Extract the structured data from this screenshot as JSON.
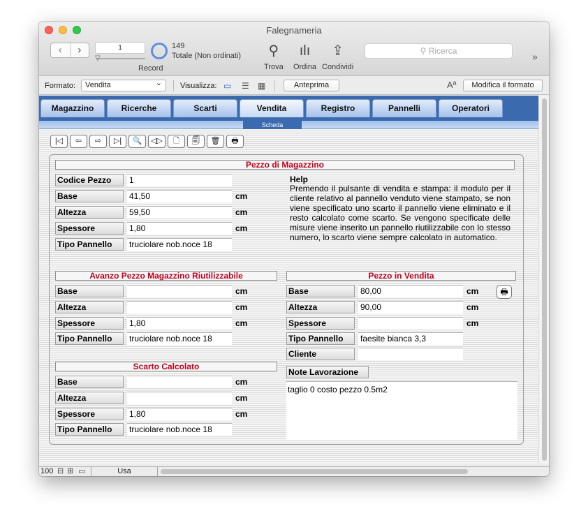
{
  "window": {
    "title": "Falegnameria"
  },
  "toolbar": {
    "record_value": "1",
    "record_label": "Record",
    "count": "149",
    "count_sub": "Totale (Non ordinati)",
    "find_label": "Trova",
    "sort_label": "Ordina",
    "share_label": "Condividi",
    "search_placeholder": "Ricerca",
    "more_icon": "»"
  },
  "formatbar": {
    "format_label": "Formato:",
    "format_value": "Vendita",
    "view_label": "Visualizza:",
    "preview_label": "Anteprima",
    "text_size_icon": "Aª",
    "edit_format_label": "Modifica il formato"
  },
  "tabs": [
    "Magazzino",
    "Ricerche",
    "Scarti",
    "Vendita",
    "Registro",
    "Pannelli",
    "Operatori"
  ],
  "subtab": "Scheda",
  "nav_buttons": [
    "|◁",
    "⇦",
    "⇨",
    "▷|",
    "🔍",
    "◁▷",
    "🗋",
    "🗐",
    "🗑",
    "🖶"
  ],
  "warehouse": {
    "title": "Pezzo di Magazzino",
    "fields": [
      {
        "label": "Codice Pezzo",
        "value": "1",
        "unit": ""
      },
      {
        "label": "Base",
        "value": "41,50",
        "unit": "cm"
      },
      {
        "label": "Altezza",
        "value": "59,50",
        "unit": "cm"
      },
      {
        "label": "Spessore",
        "value": "1,80",
        "unit": "cm"
      },
      {
        "label": "Tipo Pannello",
        "value": "truciolare nob.noce 18",
        "unit": ""
      }
    ]
  },
  "help": {
    "title": "Help",
    "text": "Premendo il pulsante di vendita e stampa: il modulo per il cliente relativo al pannello venduto viene stampato, se non viene specificato uno scarto il pannello viene eliminato e il resto calcolato come scarto. Se vengono specificate delle misure viene inserito un pannello riutilizzabile con lo stesso numero, lo scarto viene sempre calcolato in automatico."
  },
  "reusable": {
    "title": "Avanzo Pezzo Magazzino Riutilizzabile",
    "fields": [
      {
        "label": "Base",
        "value": "",
        "unit": "cm"
      },
      {
        "label": "Altezza",
        "value": "",
        "unit": "cm"
      },
      {
        "label": "Spessore",
        "value": "1,80",
        "unit": "cm"
      },
      {
        "label": "Tipo Pannello",
        "value": "truciolare nob.noce 18",
        "unit": ""
      }
    ]
  },
  "sale": {
    "title": "Pezzo in Vendita",
    "fields": [
      {
        "label": "Base",
        "value": "80,00",
        "unit": "cm"
      },
      {
        "label": "Altezza",
        "value": "90,00",
        "unit": "cm"
      },
      {
        "label": "Spessore",
        "value": "",
        "unit": "cm"
      },
      {
        "label": "Tipo Pannello",
        "value": "faesite bianca 3,3",
        "unit": ""
      },
      {
        "label": "Cliente",
        "value": "",
        "unit": ""
      }
    ],
    "print_icon": "🖶"
  },
  "waste": {
    "title": "Scarto Calcolato",
    "fields": [
      {
        "label": "Base",
        "value": "",
        "unit": "cm"
      },
      {
        "label": "Altezza",
        "value": "",
        "unit": "cm"
      },
      {
        "label": "Spessore",
        "value": "1,80",
        "unit": "cm"
      },
      {
        "label": "Tipo Pannello",
        "value": "truciolare nob.noce 18",
        "unit": ""
      }
    ]
  },
  "notes": {
    "label": "Note Lavorazione",
    "value": "taglio 0 costo pezzo 0.5m2"
  },
  "status": {
    "zoom": "100",
    "mode": "Usa"
  },
  "colors": {
    "tab_bar": "#3b6aae",
    "section_title": "#c0001e"
  }
}
